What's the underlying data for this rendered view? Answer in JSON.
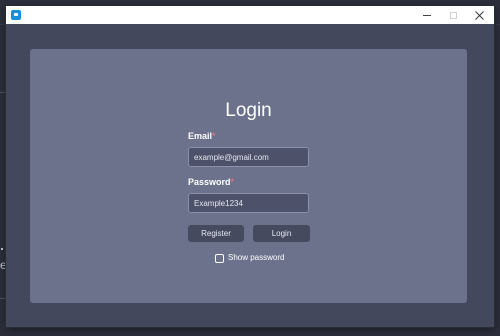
{
  "window": {
    "controls": {
      "minimize_icon": "minimize-icon",
      "maximize_icon": "maximize-icon",
      "close_icon": "close-icon"
    }
  },
  "background": {
    "fragment_text": "e"
  },
  "login": {
    "title": "Login",
    "email": {
      "label": "Email",
      "required_marker": "*",
      "value": "example@gmail.com"
    },
    "password": {
      "label": "Password",
      "required_marker": "*",
      "value": "Example1234"
    },
    "register_label": "Register",
    "login_label": "Login",
    "show_password": {
      "label": "Show password",
      "checked": false
    }
  },
  "colors": {
    "window_bg": "#44485c",
    "panel_bg": "#6c728c",
    "input_bg": "#4d5169",
    "button_bg": "#464a5f",
    "app_icon": "#1a8fdc"
  }
}
